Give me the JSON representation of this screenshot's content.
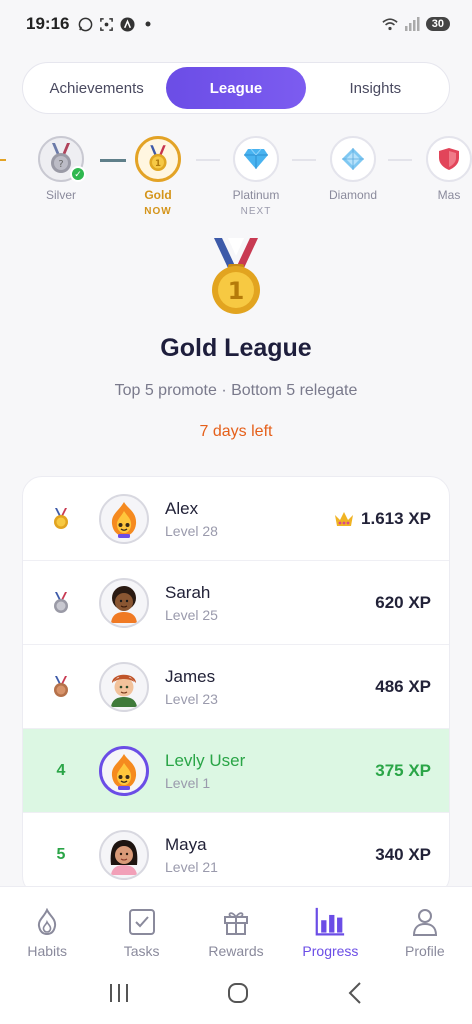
{
  "status": {
    "time": "19:16",
    "battery": "30"
  },
  "tabs": [
    {
      "label": "Achievements",
      "active": false
    },
    {
      "label": "League",
      "active": true
    },
    {
      "label": "Insights",
      "active": false
    }
  ],
  "tiers": [
    {
      "name": "Silver",
      "status": ""
    },
    {
      "name": "Gold",
      "status": "NOW"
    },
    {
      "name": "Platinum",
      "status": "NEXT"
    },
    {
      "name": "Diamond",
      "status": ""
    },
    {
      "name": "Mas",
      "status": ""
    }
  ],
  "league": {
    "title": "Gold League",
    "rule": "Top 5 promote · Bottom 5 relegate",
    "time_left": "7 days left"
  },
  "leaderboard": [
    {
      "rank": "",
      "medal": "gold-medal-icon",
      "name": "Alex",
      "level": "Level 28",
      "xp": "1.613 XP",
      "crown": true
    },
    {
      "rank": "",
      "medal": "silver-medal-icon",
      "name": "Sarah",
      "level": "Level 25",
      "xp": "620 XP"
    },
    {
      "rank": "",
      "medal": "bronze-medal-icon",
      "name": "James",
      "level": "Level 23",
      "xp": "486 XP"
    },
    {
      "rank": "4",
      "name": "Levly User",
      "level": "Level 1",
      "xp": "375 XP",
      "me": true
    },
    {
      "rank": "5",
      "name": "Maya",
      "level": "Level 21",
      "xp": "340 XP"
    }
  ],
  "nav": [
    {
      "label": "Habits",
      "icon": "flame-icon"
    },
    {
      "label": "Tasks",
      "icon": "checkbox-icon"
    },
    {
      "label": "Rewards",
      "icon": "gift-icon"
    },
    {
      "label": "Progress",
      "icon": "bar-chart-icon",
      "active": true
    },
    {
      "label": "Profile",
      "icon": "person-icon"
    }
  ],
  "colors": {
    "accent": "#6b4de6",
    "gold": "#d4941a",
    "success": "#2aa547",
    "warning": "#e5601b"
  }
}
